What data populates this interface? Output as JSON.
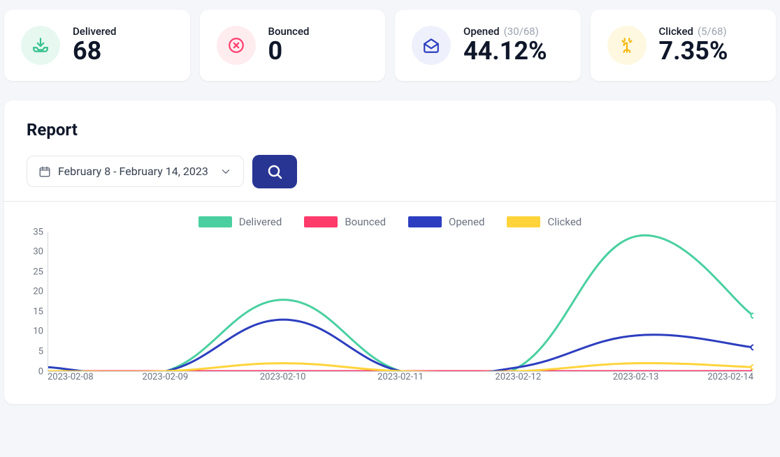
{
  "stats": {
    "delivered": {
      "label": "Delivered",
      "value": "68"
    },
    "bounced": {
      "label": "Bounced",
      "value": "0"
    },
    "opened": {
      "label": "Opened",
      "sub": "(30/68)",
      "value": "44.12%"
    },
    "clicked": {
      "label": "Clicked",
      "sub": "(5/68)",
      "value": "7.35%"
    }
  },
  "report": {
    "title": "Report",
    "date_range": "February 8 - February 14, 2023"
  },
  "colors": {
    "delivered": "#4AD0A0",
    "bounced": "#FF3B6B",
    "opened": "#2C3EBF",
    "clicked": "#FFD43B"
  },
  "chart_data": {
    "type": "line",
    "title": "",
    "xlabel": "",
    "ylabel": "",
    "ylim": [
      0,
      35
    ],
    "yticks": [
      0,
      5,
      10,
      15,
      20,
      25,
      30,
      35
    ],
    "categories": [
      "2023-02-08",
      "2023-02-09",
      "2023-02-10",
      "2023-02-11",
      "2023-02-12",
      "2023-02-13",
      "2023-02-14"
    ],
    "series": [
      {
        "name": "Delivered",
        "color_key": "delivered",
        "values": [
          1,
          0,
          18,
          0,
          1,
          34,
          14
        ]
      },
      {
        "name": "Bounced",
        "color_key": "bounced",
        "values": [
          0,
          0,
          0,
          0,
          0,
          0,
          0
        ]
      },
      {
        "name": "Opened",
        "color_key": "opened",
        "values": [
          1,
          0,
          13,
          0,
          1,
          9,
          6
        ]
      },
      {
        "name": "Clicked",
        "color_key": "clicked",
        "values": [
          0,
          0,
          2,
          0,
          0,
          2,
          1
        ]
      }
    ]
  }
}
